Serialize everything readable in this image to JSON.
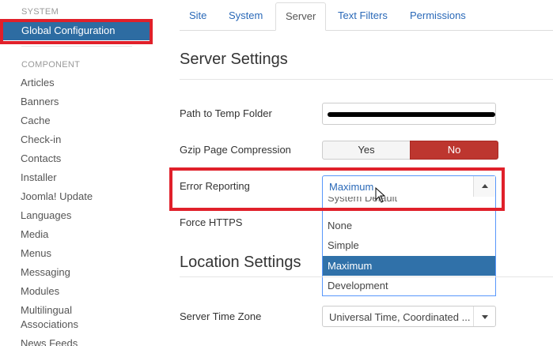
{
  "sidebar": {
    "system_heading": "SYSTEM",
    "global_configuration": "Global Configuration",
    "component_heading": "COMPONENT",
    "items": [
      "Articles",
      "Banners",
      "Cache",
      "Check-in",
      "Contacts",
      "Installer",
      "Joomla! Update",
      "Languages",
      "Media",
      "Menus",
      "Messaging",
      "Modules",
      "Multilingual Associations",
      "News Feeds"
    ]
  },
  "tabs": [
    "Site",
    "System",
    "Server",
    "Text Filters",
    "Permissions"
  ],
  "active_tab": "Server",
  "server_settings": {
    "heading": "Server Settings",
    "temp_folder_label": "Path to Temp Folder",
    "gzip_label": "Gzip Page Compression",
    "gzip_yes": "Yes",
    "gzip_no": "No",
    "error_reporting_label": "Error Reporting",
    "error_reporting_value": "Maximum",
    "error_reporting_options": [
      "System Default",
      "None",
      "Simple",
      "Maximum",
      "Development"
    ],
    "force_https_label": "Force HTTPS"
  },
  "location_settings": {
    "heading": "Location Settings",
    "timezone_label": "Server Time Zone",
    "timezone_value": "Universal Time, Coordinated ..."
  },
  "colors": {
    "accent": "#2d6ca2",
    "highlight_outline": "#e0202a",
    "no_button": "#bd362f",
    "selected_option": "#3071a9"
  }
}
